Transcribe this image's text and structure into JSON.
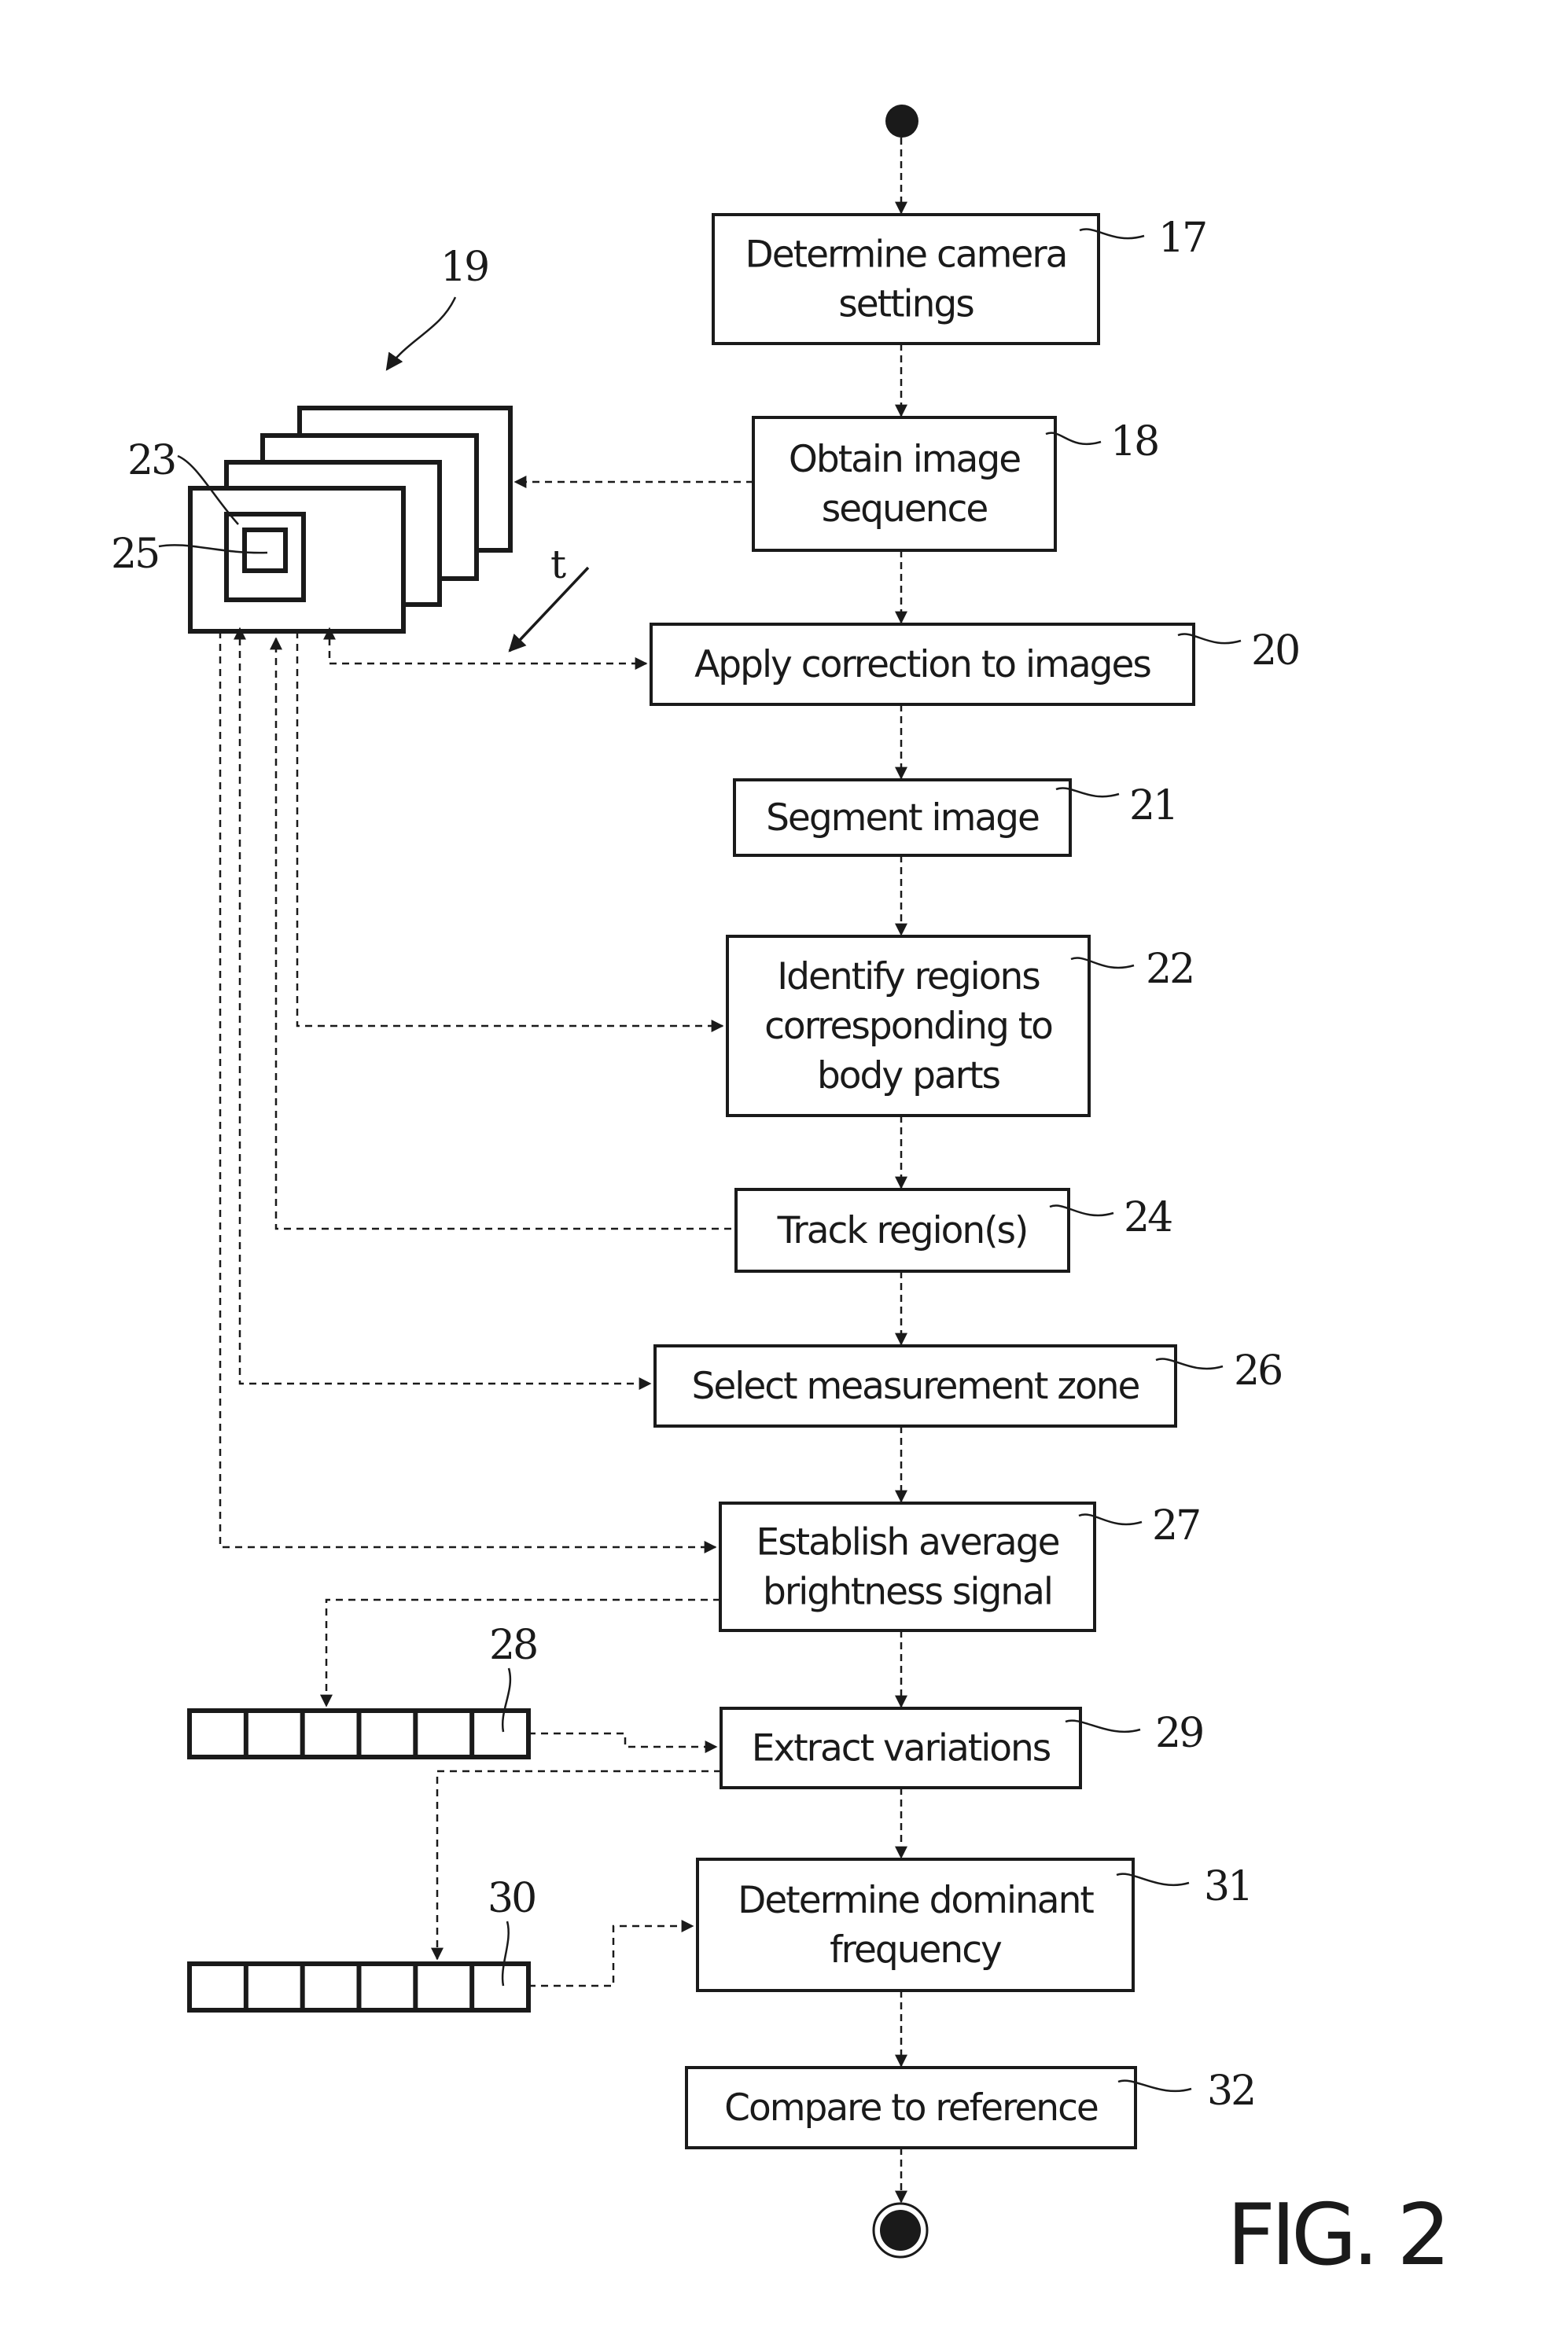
{
  "figure": {
    "label": "FIG. 2",
    "steps": [
      {
        "ref": "17",
        "lines": [
          "Determine camera",
          "settings"
        ]
      },
      {
        "ref": "18",
        "lines": [
          "Obtain image",
          "sequence"
        ]
      },
      {
        "ref": "20",
        "lines": [
          "Apply correction to images"
        ]
      },
      {
        "ref": "21",
        "lines": [
          "Segment image"
        ]
      },
      {
        "ref": "22",
        "lines": [
          "Identify regions",
          "corresponding to",
          "body parts"
        ]
      },
      {
        "ref": "24",
        "lines": [
          "Track region(s)"
        ]
      },
      {
        "ref": "26",
        "lines": [
          "Select measurement zone"
        ]
      },
      {
        "ref": "27",
        "lines": [
          "Establish average",
          "brightness signal"
        ]
      },
      {
        "ref": "29",
        "lines": [
          "Extract variations"
        ]
      },
      {
        "ref": "31",
        "lines": [
          "Determine dominant",
          "frequency"
        ]
      },
      {
        "ref": "32",
        "lines": [
          "Compare to reference"
        ]
      }
    ],
    "image_sequence": {
      "ref": "19",
      "frame_count": 4,
      "region_ref": "23",
      "zone_ref": "25",
      "time_label": "t"
    },
    "buffers": [
      {
        "ref": "28",
        "cells": 6
      },
      {
        "ref": "30",
        "cells": 6
      }
    ],
    "start_node": "start",
    "end_node": "end"
  }
}
